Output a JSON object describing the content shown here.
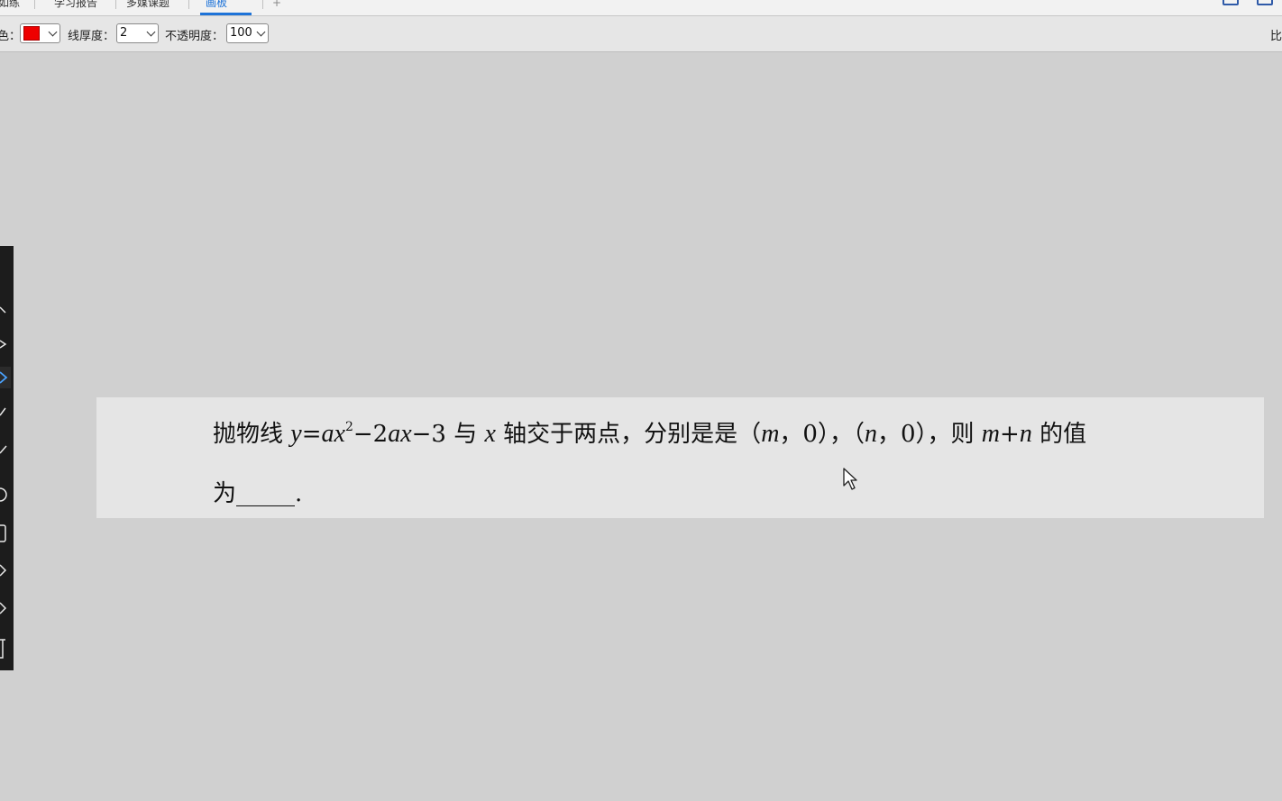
{
  "tabs": [
    {
      "label": "如练"
    },
    {
      "label": "学习报告"
    },
    {
      "label": "多媒课题"
    },
    {
      "label": "画板"
    },
    {
      "label": "+"
    }
  ],
  "toolbar": {
    "color_label": "色：",
    "color_value": "#ee0000",
    "thickness_label": "线厚度：",
    "thickness_value": "2",
    "opacity_label": "不透明度：",
    "opacity_value": "100",
    "right_text": "比"
  },
  "question": {
    "line1_prefix": "抛物线 ",
    "line1_y": "y",
    "line1_eq": "=",
    "line1_ax": "ax",
    "line1_sup": "2",
    "line1_mid1": "−2",
    "line1_ax2": "ax",
    "line1_mid2": "−3 与 ",
    "line1_x": "x",
    "line1_mid3": " 轴交于两点，分别是是（",
    "line1_m": "m",
    "line1_mid4": "，0），（",
    "line1_n": "n",
    "line1_mid5": "，0），则 ",
    "line1_m2": "m",
    "line1_plus": "+",
    "line1_n2": "n",
    "line1_suffix": " 的值",
    "line2": "为_____."
  },
  "colors": {
    "accent": "#1e73d8",
    "pen": "#ee0000",
    "canvas": "#d0d0d0",
    "card": "#e5e5e5"
  }
}
